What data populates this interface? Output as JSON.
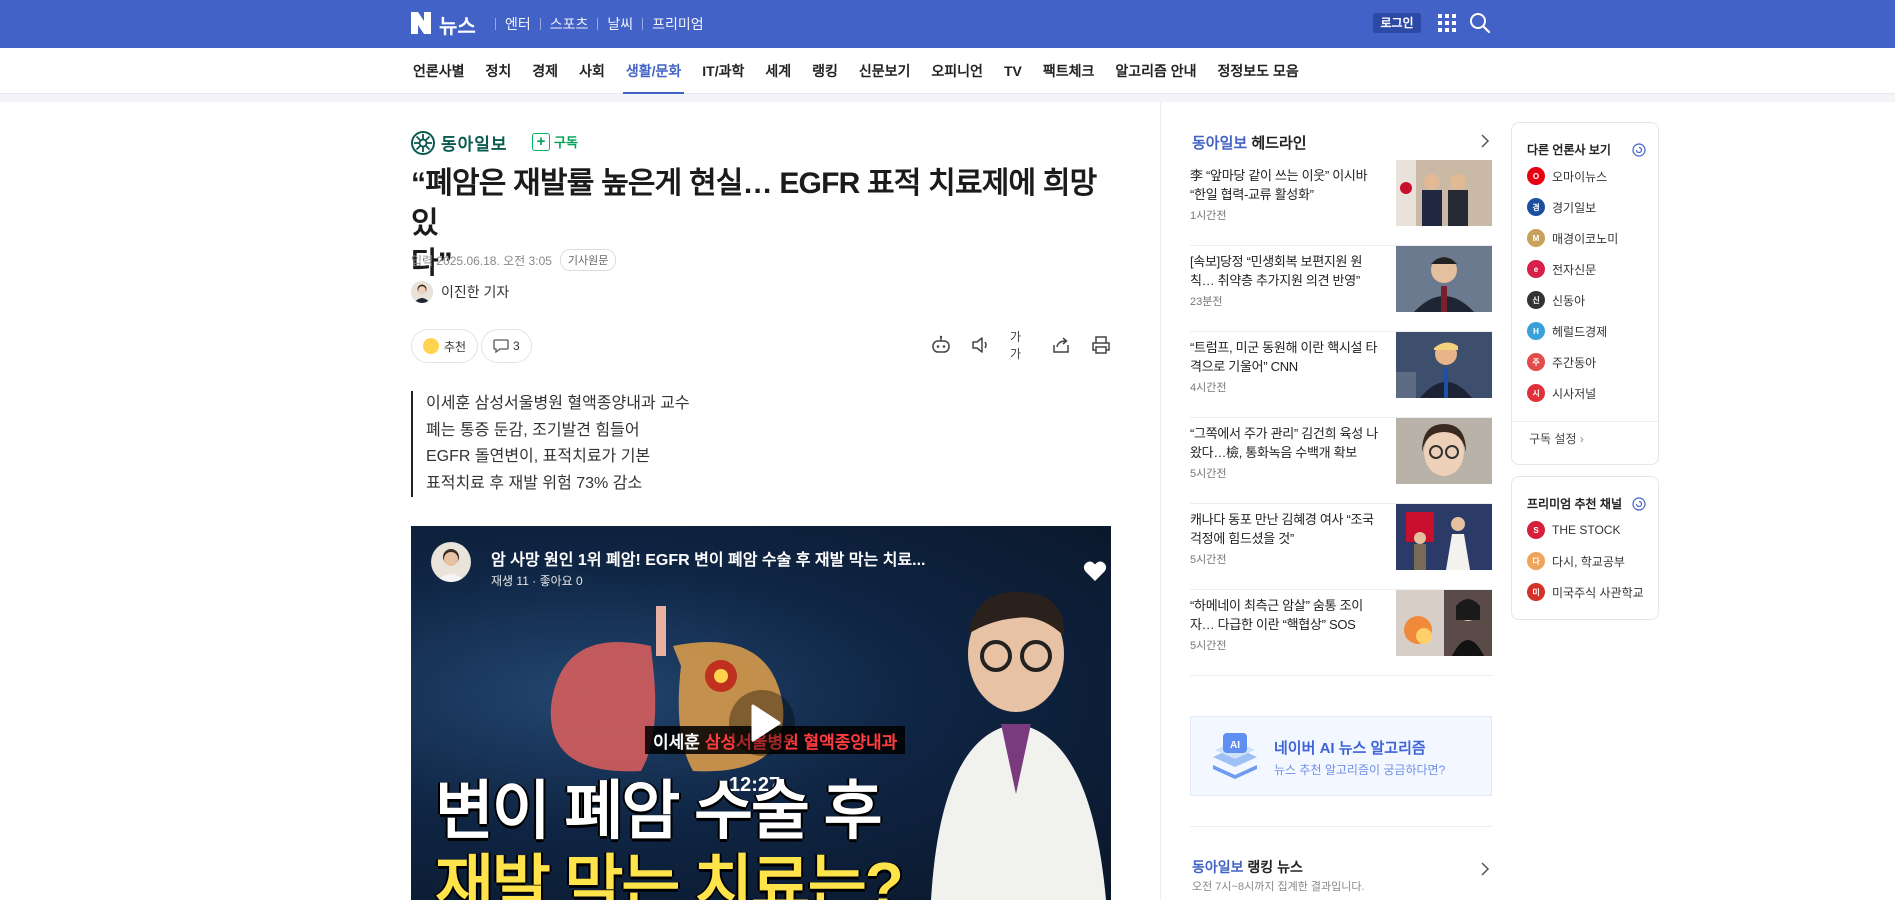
{
  "header": {
    "logo_text": "뉴스",
    "links": [
      "엔터",
      "스포츠",
      "날씨",
      "프리미엄"
    ],
    "login": "로그인"
  },
  "nav": {
    "items": [
      "언론사별",
      "정치",
      "경제",
      "사회",
      "생활/문화",
      "IT/과학",
      "세계",
      "랭킹",
      "신문보기",
      "오피니언",
      "TV",
      "팩트체크",
      "알고리즘 안내",
      "정정보도 모음"
    ],
    "active": "생활/문화"
  },
  "article": {
    "press": "동아일보",
    "subscribe": "구독",
    "headline_1": "“폐암은 재발률 높은게 현실… EGFR 표적 치료제에 희망 있",
    "headline_2": "다”",
    "date": "입력 2025.06.18. 오전 3:05",
    "origin": "기사원문",
    "reporter": "이진한 기자",
    "recommend": "추천",
    "comments": "3",
    "font_tool": "가가",
    "summary": [
      "이세훈 삼성서울병원 혈액종양내과 교수",
      "폐는 통증 둔감, 조기발견 힘들어",
      "EGFR 돌연변이, 표적치료가 기본",
      "표적치료 후 재발 위험 73% 감소"
    ]
  },
  "video": {
    "title": "암 사망 원인 1위 폐암! EGFR 변이 폐암 수술 후 재발 막는 치료...",
    "views": "재생 11",
    "likes": "좋아요 0",
    "lower_third_name": "이세훈",
    "lower_third_org": "삼성서울병원 혈액종양내과",
    "duration": "12:27",
    "caption_1": "변이 폐암 수술 후",
    "caption_2": "재발 막는 치료는?"
  },
  "headlines": {
    "press": "동아일보",
    "title": "헤드라인",
    "items": [
      {
        "title": "李 “앞마당 같이 쓰는 이웃” 이시바 “한일 협력-교류 활성화”",
        "time": "1시간전"
      },
      {
        "title": "[속보]당정 “민생회복 보편지원 원칙… 취약층 추가지원 의견 반영”",
        "time": "23분전"
      },
      {
        "title": "“트럼프, 미군 동원해 이란 핵시설 타격으로 기울어” CNN",
        "time": "4시간전"
      },
      {
        "title": "“그쪽에서 주가 관리” 김건희 육성 나왔다…檢, 통화녹음 수백개 확보",
        "time": "5시간전"
      },
      {
        "title": "캐나다 동포 만난 김혜경 여사 “조국 걱정에 힘드셨을 것”",
        "time": "5시간전"
      },
      {
        "title": "“하메네이 최측근 암살” 숨통 조이자… 다급한 이란 “핵협상” SOS",
        "time": "5시간전"
      }
    ]
  },
  "ai_box": {
    "title": "네이버 AI 뉴스 알고리즘",
    "subtitle": "뉴스 추천 알고리즘이 궁금하다면?",
    "icon_text": "AI"
  },
  "ranking": {
    "press": "동아일보",
    "title": "랭킹 뉴스",
    "subtitle": "오전 7시~8시까지 집계한 결과입니다."
  },
  "other_press": {
    "title": "다른 언론사 보기",
    "items": [
      {
        "name": "오마이뉴스",
        "color": "#e60012",
        "mark": "O"
      },
      {
        "name": "경기일보",
        "color": "#1d4fa0",
        "mark": "경"
      },
      {
        "name": "매경이코노미",
        "color": "#c8a15a",
        "mark": "M"
      },
      {
        "name": "전자신문",
        "color": "#d6224b",
        "mark": "e"
      },
      {
        "name": "신동아",
        "color": "#333333",
        "mark": "신"
      },
      {
        "name": "헤럴드경제",
        "color": "#3aa0d8",
        "mark": "H"
      },
      {
        "name": "주간동아",
        "color": "#e24b4b",
        "mark": "주"
      },
      {
        "name": "시사저널",
        "color": "#e0303a",
        "mark": "시"
      }
    ],
    "settings": "구독 설정"
  },
  "premium": {
    "title": "프리미엄 추천 채널",
    "items": [
      {
        "name": "THE STOCK",
        "color": "#d61f3a",
        "mark": "S"
      },
      {
        "name": "다시, 학교공부",
        "color": "#f0a35a",
        "mark": "다"
      },
      {
        "name": "미국주식 사관학교",
        "color": "#d6322a",
        "mark": "미"
      }
    ]
  }
}
